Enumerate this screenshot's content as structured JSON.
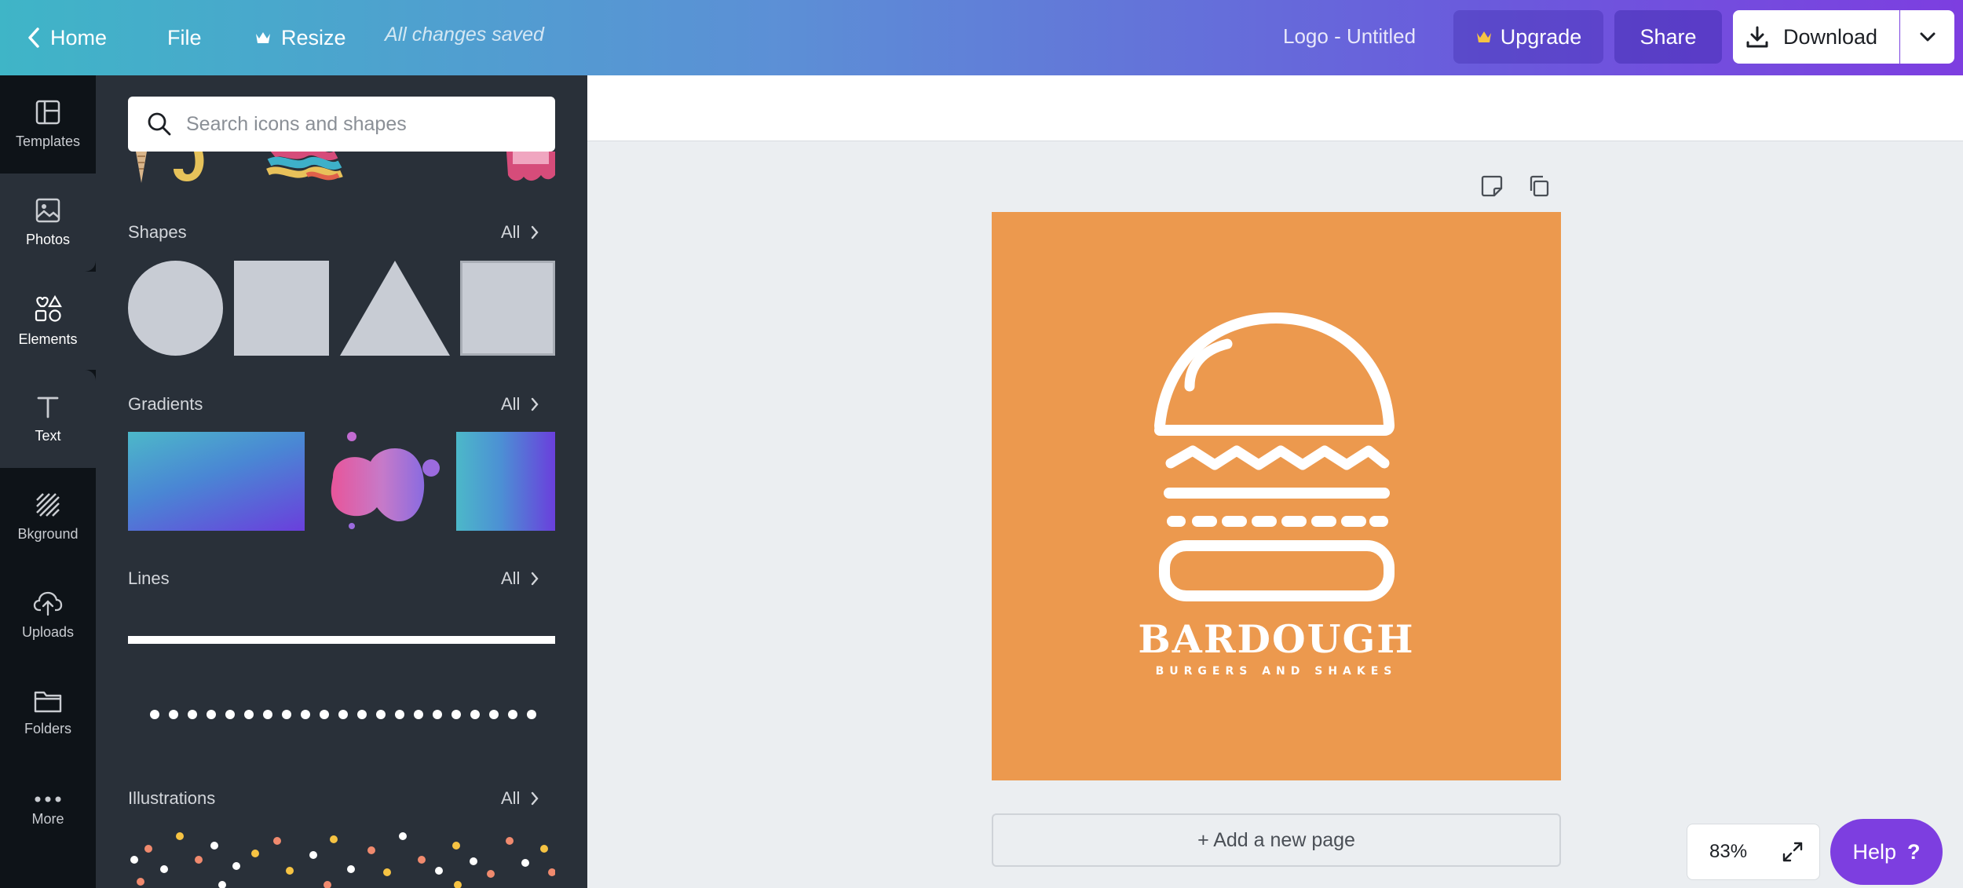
{
  "topbar": {
    "home_label": "Home",
    "file_label": "File",
    "resize_label": "Resize",
    "saved_status": "All changes saved",
    "doc_title": "Logo - Untitled",
    "upgrade_label": "Upgrade",
    "share_label": "Share",
    "download_label": "Download"
  },
  "rail": {
    "items": [
      {
        "label": "Templates",
        "icon": "templates-icon"
      },
      {
        "label": "Photos",
        "icon": "photos-icon"
      },
      {
        "label": "Elements",
        "icon": "elements-icon",
        "active": true
      },
      {
        "label": "Text",
        "icon": "text-icon"
      },
      {
        "label": "Bkground",
        "icon": "background-icon"
      },
      {
        "label": "Uploads",
        "icon": "uploads-icon"
      },
      {
        "label": "Folders",
        "icon": "folders-icon"
      },
      {
        "label": "More",
        "icon": "more-icon"
      }
    ]
  },
  "panel": {
    "search_placeholder": "Search icons and shapes",
    "sections": {
      "shapes": {
        "title": "Shapes",
        "all": "All"
      },
      "gradients": {
        "title": "Gradients",
        "all": "All"
      },
      "lines": {
        "title": "Lines",
        "all": "All"
      },
      "illustrations": {
        "title": "Illustrations",
        "all": "All"
      }
    }
  },
  "canvas": {
    "page_color": "#ec994e",
    "logo_name": "BARDOUGH",
    "logo_tagline": "BURGERS AND SHAKES",
    "add_page_label": "+ Add a new page"
  },
  "footer": {
    "zoom_level": "83%",
    "help_label": "Help",
    "help_glyph": "?"
  },
  "colors": {
    "accent": "#7d3ee0",
    "panel_bg": "#293039",
    "rail_bg": "#0e1318"
  }
}
